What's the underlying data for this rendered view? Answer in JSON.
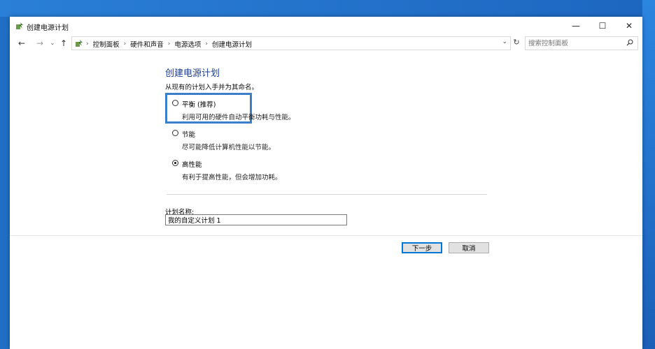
{
  "window": {
    "title": "创建电源计划",
    "controls": {
      "minimize": "—",
      "maximize": "☐",
      "close": "✕"
    }
  },
  "address_bar": {
    "breadcrumbs": [
      "控制面板",
      "硬件和声音",
      "电源选项",
      "创建电源计划"
    ],
    "search_placeholder": "搜索控制面板"
  },
  "page": {
    "title": "创建电源计划",
    "intro": "从现有的计划入手并为其命名。",
    "options": [
      {
        "label": "平衡 (推荐)",
        "description": "利用可用的硬件自动平衡功耗与性能。",
        "selected": false
      },
      {
        "label": "节能",
        "description": "尽可能降低计算机性能以节能。",
        "selected": false
      },
      {
        "label": "高性能",
        "description": "有利于提高性能，但会增加功耗。",
        "selected": true
      }
    ],
    "plan_name_label": "计划名称:",
    "plan_name_value": "我的自定义计划 1"
  },
  "buttons": {
    "next": "下一步",
    "cancel": "取消"
  },
  "colors": {
    "title_blue": "#1e3d8f",
    "highlight": "#3a7fc8",
    "desktop": "#1f6fc4"
  }
}
